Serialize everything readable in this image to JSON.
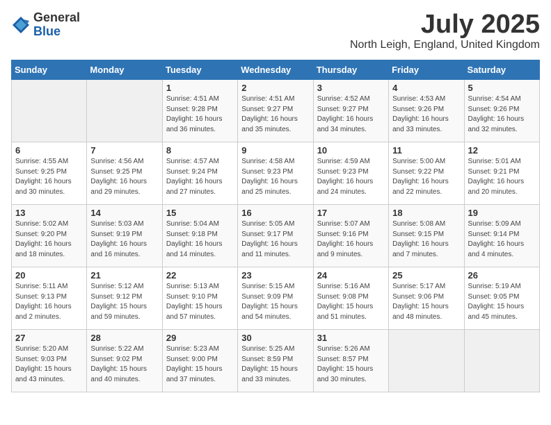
{
  "logo": {
    "general": "General",
    "blue": "Blue"
  },
  "title": {
    "month": "July 2025",
    "location": "North Leigh, England, United Kingdom"
  },
  "weekdays": [
    "Sunday",
    "Monday",
    "Tuesday",
    "Wednesday",
    "Thursday",
    "Friday",
    "Saturday"
  ],
  "weeks": [
    [
      {
        "day": "",
        "info": ""
      },
      {
        "day": "",
        "info": ""
      },
      {
        "day": "1",
        "info": "Sunrise: 4:51 AM\nSunset: 9:28 PM\nDaylight: 16 hours\nand 36 minutes."
      },
      {
        "day": "2",
        "info": "Sunrise: 4:51 AM\nSunset: 9:27 PM\nDaylight: 16 hours\nand 35 minutes."
      },
      {
        "day": "3",
        "info": "Sunrise: 4:52 AM\nSunset: 9:27 PM\nDaylight: 16 hours\nand 34 minutes."
      },
      {
        "day": "4",
        "info": "Sunrise: 4:53 AM\nSunset: 9:26 PM\nDaylight: 16 hours\nand 33 minutes."
      },
      {
        "day": "5",
        "info": "Sunrise: 4:54 AM\nSunset: 9:26 PM\nDaylight: 16 hours\nand 32 minutes."
      }
    ],
    [
      {
        "day": "6",
        "info": "Sunrise: 4:55 AM\nSunset: 9:25 PM\nDaylight: 16 hours\nand 30 minutes."
      },
      {
        "day": "7",
        "info": "Sunrise: 4:56 AM\nSunset: 9:25 PM\nDaylight: 16 hours\nand 29 minutes."
      },
      {
        "day": "8",
        "info": "Sunrise: 4:57 AM\nSunset: 9:24 PM\nDaylight: 16 hours\nand 27 minutes."
      },
      {
        "day": "9",
        "info": "Sunrise: 4:58 AM\nSunset: 9:23 PM\nDaylight: 16 hours\nand 25 minutes."
      },
      {
        "day": "10",
        "info": "Sunrise: 4:59 AM\nSunset: 9:23 PM\nDaylight: 16 hours\nand 24 minutes."
      },
      {
        "day": "11",
        "info": "Sunrise: 5:00 AM\nSunset: 9:22 PM\nDaylight: 16 hours\nand 22 minutes."
      },
      {
        "day": "12",
        "info": "Sunrise: 5:01 AM\nSunset: 9:21 PM\nDaylight: 16 hours\nand 20 minutes."
      }
    ],
    [
      {
        "day": "13",
        "info": "Sunrise: 5:02 AM\nSunset: 9:20 PM\nDaylight: 16 hours\nand 18 minutes."
      },
      {
        "day": "14",
        "info": "Sunrise: 5:03 AM\nSunset: 9:19 PM\nDaylight: 16 hours\nand 16 minutes."
      },
      {
        "day": "15",
        "info": "Sunrise: 5:04 AM\nSunset: 9:18 PM\nDaylight: 16 hours\nand 14 minutes."
      },
      {
        "day": "16",
        "info": "Sunrise: 5:05 AM\nSunset: 9:17 PM\nDaylight: 16 hours\nand 11 minutes."
      },
      {
        "day": "17",
        "info": "Sunrise: 5:07 AM\nSunset: 9:16 PM\nDaylight: 16 hours\nand 9 minutes."
      },
      {
        "day": "18",
        "info": "Sunrise: 5:08 AM\nSunset: 9:15 PM\nDaylight: 16 hours\nand 7 minutes."
      },
      {
        "day": "19",
        "info": "Sunrise: 5:09 AM\nSunset: 9:14 PM\nDaylight: 16 hours\nand 4 minutes."
      }
    ],
    [
      {
        "day": "20",
        "info": "Sunrise: 5:11 AM\nSunset: 9:13 PM\nDaylight: 16 hours\nand 2 minutes."
      },
      {
        "day": "21",
        "info": "Sunrise: 5:12 AM\nSunset: 9:12 PM\nDaylight: 15 hours\nand 59 minutes."
      },
      {
        "day": "22",
        "info": "Sunrise: 5:13 AM\nSunset: 9:10 PM\nDaylight: 15 hours\nand 57 minutes."
      },
      {
        "day": "23",
        "info": "Sunrise: 5:15 AM\nSunset: 9:09 PM\nDaylight: 15 hours\nand 54 minutes."
      },
      {
        "day": "24",
        "info": "Sunrise: 5:16 AM\nSunset: 9:08 PM\nDaylight: 15 hours\nand 51 minutes."
      },
      {
        "day": "25",
        "info": "Sunrise: 5:17 AM\nSunset: 9:06 PM\nDaylight: 15 hours\nand 48 minutes."
      },
      {
        "day": "26",
        "info": "Sunrise: 5:19 AM\nSunset: 9:05 PM\nDaylight: 15 hours\nand 45 minutes."
      }
    ],
    [
      {
        "day": "27",
        "info": "Sunrise: 5:20 AM\nSunset: 9:03 PM\nDaylight: 15 hours\nand 43 minutes."
      },
      {
        "day": "28",
        "info": "Sunrise: 5:22 AM\nSunset: 9:02 PM\nDaylight: 15 hours\nand 40 minutes."
      },
      {
        "day": "29",
        "info": "Sunrise: 5:23 AM\nSunset: 9:00 PM\nDaylight: 15 hours\nand 37 minutes."
      },
      {
        "day": "30",
        "info": "Sunrise: 5:25 AM\nSunset: 8:59 PM\nDaylight: 15 hours\nand 33 minutes."
      },
      {
        "day": "31",
        "info": "Sunrise: 5:26 AM\nSunset: 8:57 PM\nDaylight: 15 hours\nand 30 minutes."
      },
      {
        "day": "",
        "info": ""
      },
      {
        "day": "",
        "info": ""
      }
    ]
  ]
}
